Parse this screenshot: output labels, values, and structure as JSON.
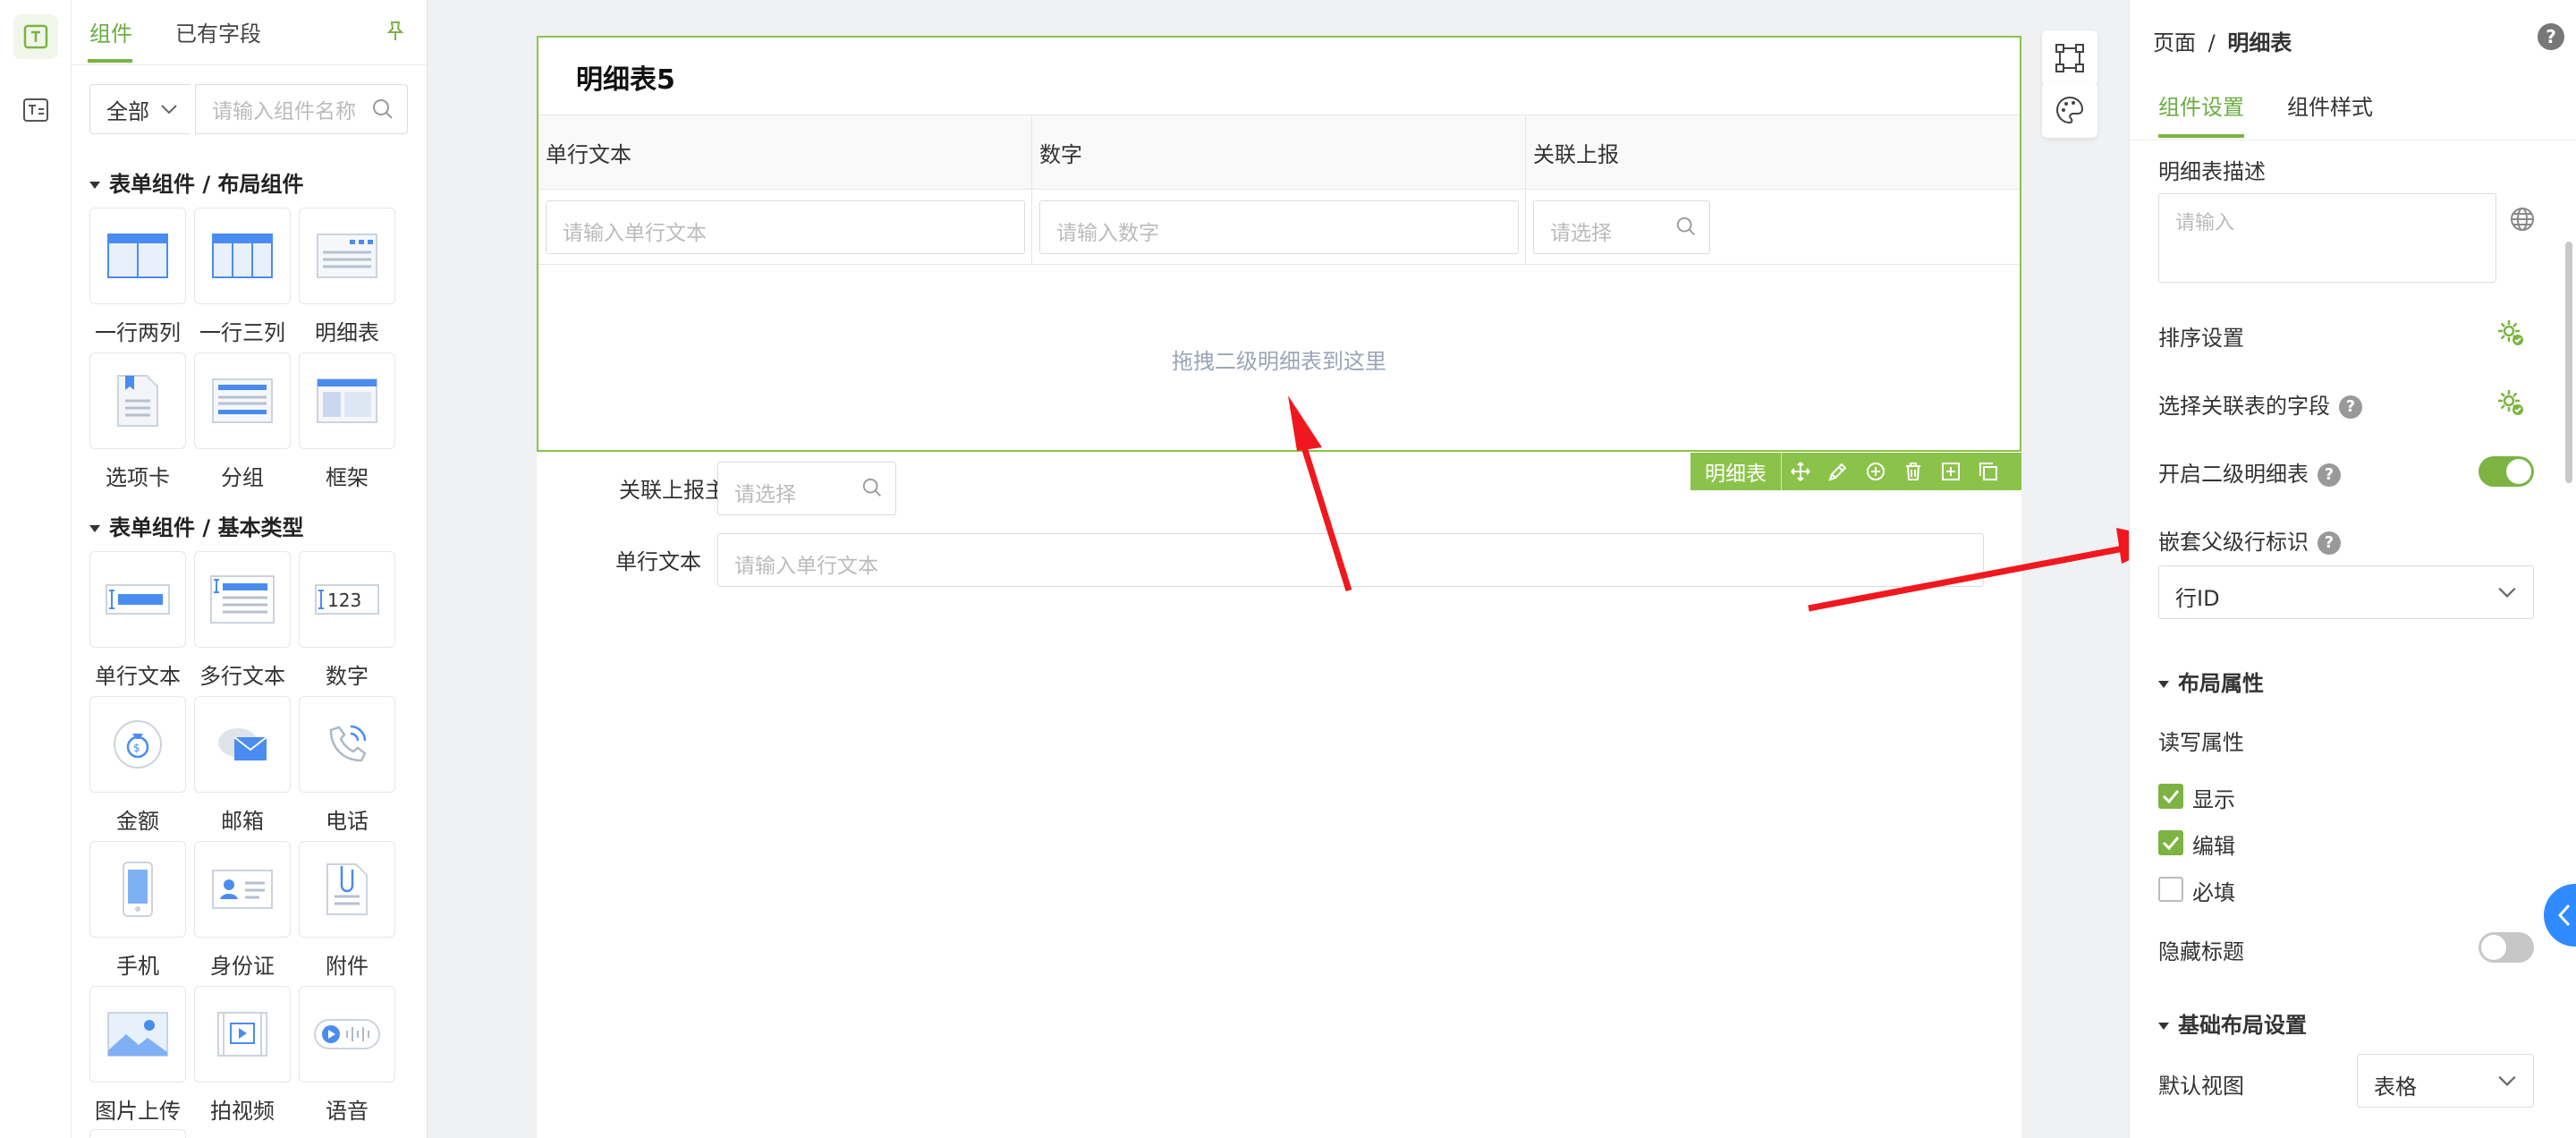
{
  "left_tabs": {
    "components": "组件",
    "existing_fields": "已有字段"
  },
  "filter": {
    "scope": "全部",
    "search_placeholder": "请输入组件名称"
  },
  "section_layout": "表单组件 / 布局组件",
  "layout_components": [
    {
      "label": "一行两列",
      "icon": "two-column-icon"
    },
    {
      "label": "一行三列",
      "icon": "three-column-icon"
    },
    {
      "label": "明细表",
      "icon": "detail-table-icon"
    },
    {
      "label": "选项卡",
      "icon": "tabs-icon"
    },
    {
      "label": "分组",
      "icon": "group-icon"
    },
    {
      "label": "框架",
      "icon": "frame-icon"
    }
  ],
  "section_basic": "表单组件 / 基本类型",
  "basic_components": [
    {
      "label": "单行文本",
      "icon": "single-line-text-icon"
    },
    {
      "label": "多行文本",
      "icon": "multi-line-text-icon"
    },
    {
      "label": "数字",
      "icon": "number-icon"
    },
    {
      "label": "金额",
      "icon": "money-icon"
    },
    {
      "label": "邮箱",
      "icon": "email-icon"
    },
    {
      "label": "电话",
      "icon": "phone-icon"
    },
    {
      "label": "手机",
      "icon": "mobile-icon"
    },
    {
      "label": "身份证",
      "icon": "id-card-icon"
    },
    {
      "label": "附件",
      "icon": "attachment-icon"
    },
    {
      "label": "图片上传",
      "icon": "image-upload-icon"
    },
    {
      "label": "拍视频",
      "icon": "video-icon"
    },
    {
      "label": "语音",
      "icon": "voice-icon"
    }
  ],
  "number_icon_text": "123",
  "canvas": {
    "table_title": "明细表5",
    "columns": [
      {
        "header": "单行文本",
        "placeholder": "请输入单行文本"
      },
      {
        "header": "数字",
        "placeholder": "请输入数字"
      },
      {
        "header": "关联上报",
        "placeholder": "请选择"
      }
    ],
    "drop_hint": "拖拽二级明细表到这里",
    "toolbar_label": "明细表",
    "form_rows": [
      {
        "label": "关联上报主表",
        "placeholder": "请选择"
      },
      {
        "label": "单行文本",
        "placeholder": "请输入单行文本"
      }
    ]
  },
  "right": {
    "breadcrumb_root": "页面",
    "breadcrumb_sep": "/",
    "breadcrumb_current": "明细表",
    "tab_settings": "组件设置",
    "tab_style": "组件样式",
    "desc_label": "明细表描述",
    "desc_placeholder": "请输入",
    "sort_label": "排序设置",
    "assoc_fields_label": "选择关联表的字段",
    "enable_sub_label": "开启二级明细表",
    "enable_sub_on": true,
    "nested_parent_label": "嵌套父级行标识",
    "nested_parent_value": "行ID",
    "layout_props_title": "布局属性",
    "rw_label": "读写属性",
    "cb_show": "显示",
    "cb_edit": "编辑",
    "cb_required": "必填",
    "hide_title_label": "隐藏标题",
    "hide_title_on": false,
    "basic_layout_title": "基础布局设置",
    "default_view_label": "默认视图",
    "default_view_value": "表格",
    "accent": "#7cb342"
  }
}
